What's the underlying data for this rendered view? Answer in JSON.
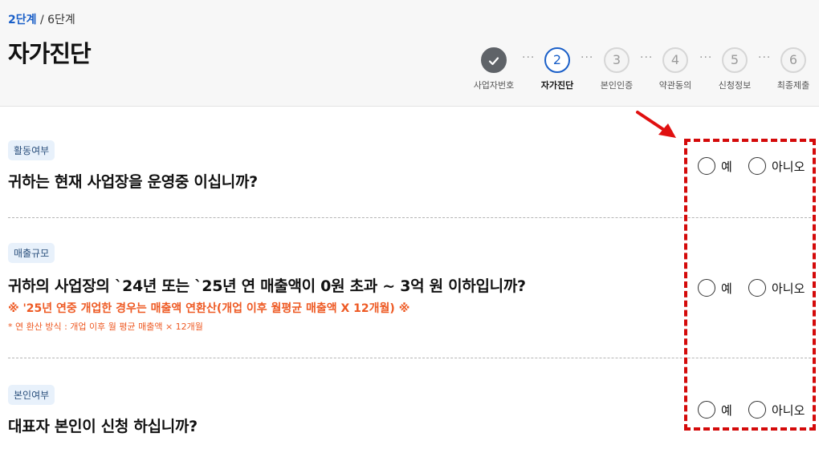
{
  "header": {
    "current_step": "2단계",
    "total_steps": "/ 6단계",
    "title": "자가진단"
  },
  "stepper": {
    "steps": [
      {
        "number": "",
        "label": "사업자번호",
        "state": "done"
      },
      {
        "number": "2",
        "label": "자가진단",
        "state": "active"
      },
      {
        "number": "3",
        "label": "본인인증",
        "state": "pending"
      },
      {
        "number": "4",
        "label": "약관동의",
        "state": "pending"
      },
      {
        "number": "5",
        "label": "신청정보",
        "state": "pending"
      },
      {
        "number": "6",
        "label": "최종제출",
        "state": "pending"
      }
    ],
    "connector": "···"
  },
  "questions": [
    {
      "badge": "활동여부",
      "text": "귀하는 현재 사업장을 운영중 이십니까?",
      "options": {
        "yes": "예",
        "no": "아니오"
      }
    },
    {
      "badge": "매출규모",
      "text": "귀하의 사업장의 `24년 또는 `25년 연 매출액이 0원 초과 ~ 3억 원 이하입니까?",
      "note1": "※ '25년 연중 개업한 경우는 매출액 연환산(개업 이후 월평균 매출액 X 12개월) ※",
      "note2": "* 연 환산 방식 : 개업 이후 월 평균 매출액 × 12개월",
      "options": {
        "yes": "예",
        "no": "아니오"
      }
    },
    {
      "badge": "본인여부",
      "text": "대표자 본인이 신청 하십니까?",
      "options": {
        "yes": "예",
        "no": "아니오"
      }
    }
  ],
  "colors": {
    "accent": "#1a5fc8",
    "warning": "#ee5a24",
    "highlight": "#d40a0a",
    "badge_bg": "#e8f1fb"
  },
  "icons": {
    "done_step": "check-icon",
    "annotation": "red-arrow-icon"
  }
}
